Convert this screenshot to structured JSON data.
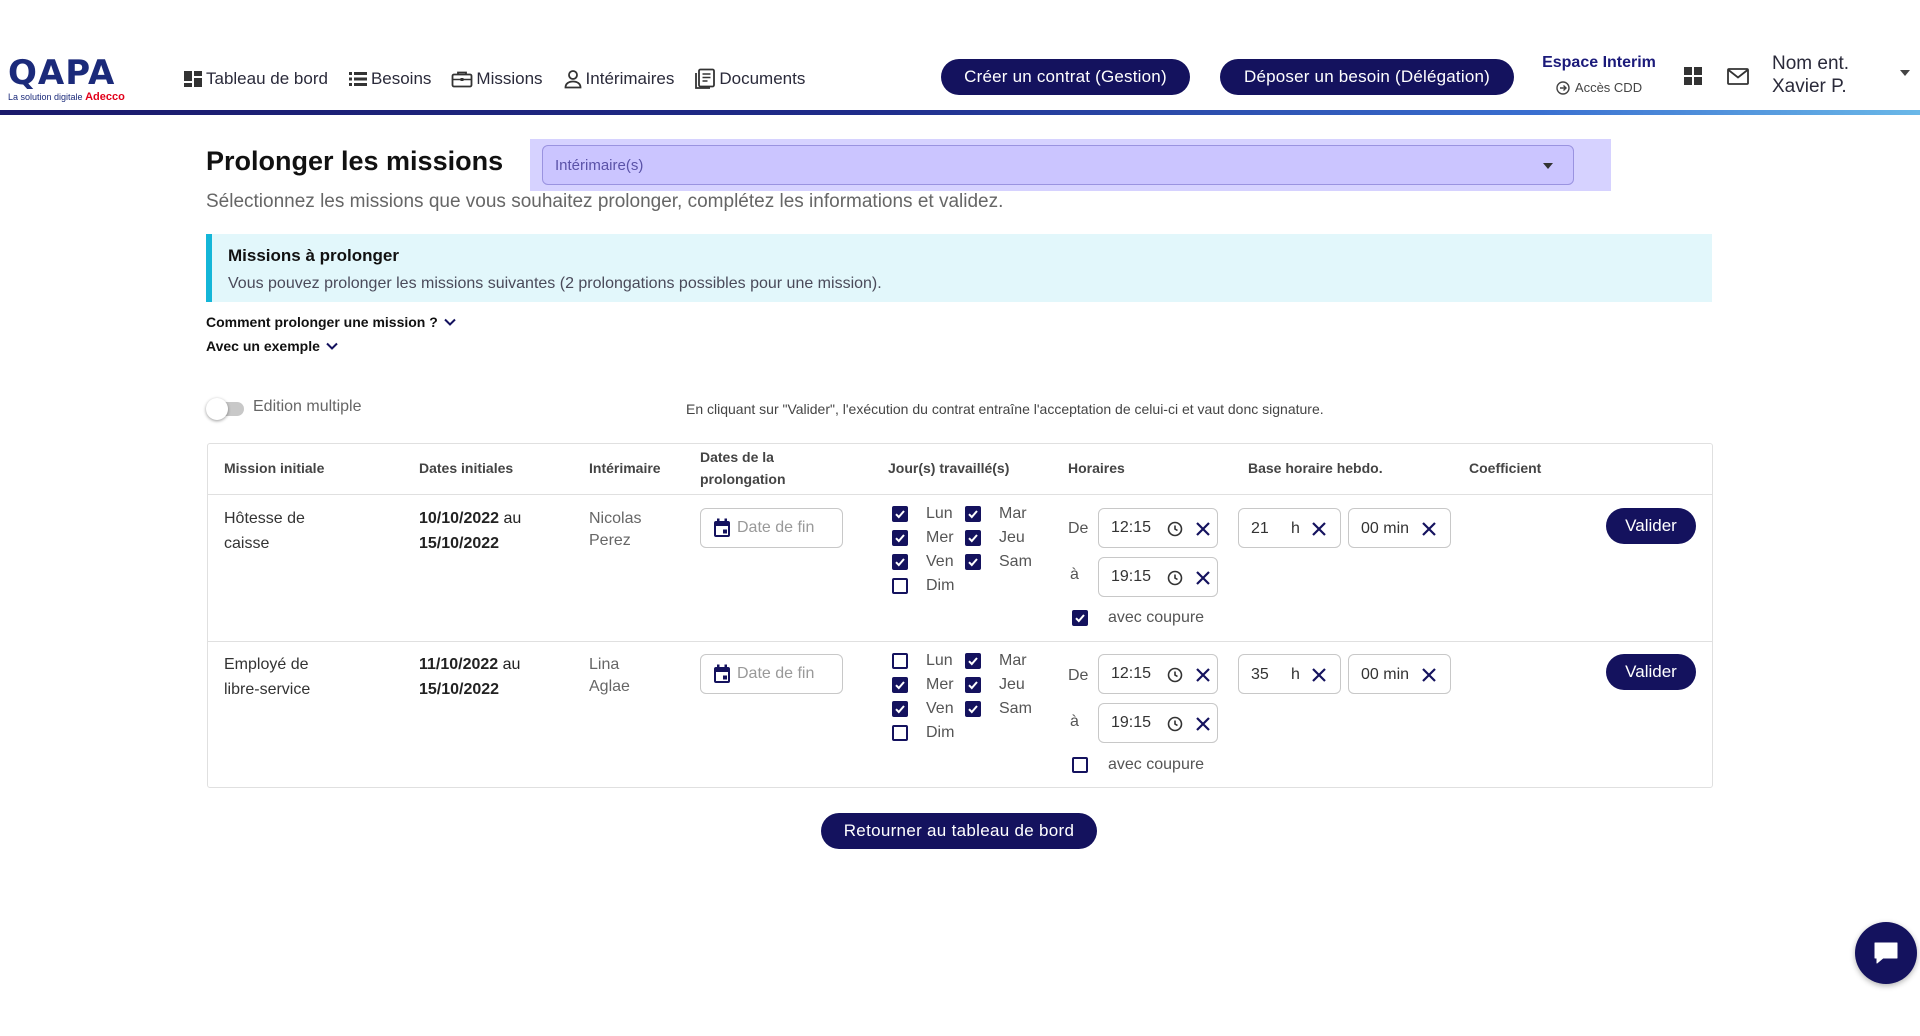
{
  "logo": {
    "main": "QAPA",
    "sub": "La solution digitale",
    "brand": "Adecco"
  },
  "nav": [
    {
      "label": "Tableau de bord",
      "icon": "dashboard-icon"
    },
    {
      "label": "Besoins",
      "icon": "list-icon"
    },
    {
      "label": "Missions",
      "icon": "briefcase-icon"
    },
    {
      "label": "Intérimaires",
      "icon": "person-icon"
    },
    {
      "label": "Documents",
      "icon": "documents-icon"
    }
  ],
  "header": {
    "create_contract_label": "Créer un contrat (Gestion)",
    "post_need_label": "Déposer un besoin (Délégation)",
    "espace_title": "Espace Interim",
    "espace_sub": "Accès CDD",
    "user_company": "Nom ent.",
    "user_name": "Xavier P."
  },
  "page": {
    "title": "Prolonger les missions",
    "select_placeholder": "Intérimaire(s)",
    "subtitle": "Sélectionnez les missions que vous souhaitez prolonger, complétez les informations et validez."
  },
  "info": {
    "title": "Missions à prolonger",
    "text": "Vous pouvez prolonger les missions suivantes (2 prolongations possibles pour une mission)."
  },
  "help": {
    "how_label": "Comment prolonger une mission ?",
    "example_label": "Avec un exemple"
  },
  "edition_multiple_label": "Edition multiple",
  "disclaimer": "En cliquant sur \"Valider\", l'exécution du contrat entraîne l'acceptation de celui-ci et vaut donc signature.",
  "table": {
    "headers": {
      "mission": "Mission initiale",
      "dates": "Dates initiales",
      "interimaire": "Intérimaire",
      "prolongation_1": "Dates de la",
      "prolongation_2": "prolongation",
      "jours": "Jour(s) travaillé(s)",
      "horaires": "Horaires",
      "base": "Base horaire hebdo.",
      "coefficient": "Coefficient"
    },
    "labels": {
      "de": "De",
      "a": "à",
      "h": "h",
      "coupure": "avec coupure",
      "date_placeholder": "Date de fin",
      "valider": "Valider",
      "au": "au"
    },
    "rows": [
      {
        "mission_1": "Hôtesse de",
        "mission_2": "caisse",
        "date_start": "10/10/2022",
        "date_end": "15/10/2022",
        "interimaire_1": "Nicolas",
        "interimaire_2": "Perez",
        "days": {
          "lun": {
            "label": "Lun",
            "checked": true
          },
          "mar": {
            "label": "Mar",
            "checked": true
          },
          "mer": {
            "label": "Mer",
            "checked": true
          },
          "jeu": {
            "label": "Jeu",
            "checked": true
          },
          "ven": {
            "label": "Ven",
            "checked": true
          },
          "sam": {
            "label": "Sam",
            "checked": true
          },
          "dim": {
            "label": "Dim",
            "checked": false
          }
        },
        "time_from": "12:15",
        "time_to": "19:15",
        "coupure": true,
        "hours": "21",
        "minutes": "00 min"
      },
      {
        "mission_1": "Employé de",
        "mission_2": "libre-service",
        "date_start": "11/10/2022",
        "date_end": "15/10/2022",
        "interimaire_1": "Lina",
        "interimaire_2": "Aglae",
        "days": {
          "lun": {
            "label": "Lun",
            "checked": false
          },
          "mar": {
            "label": "Mar",
            "checked": true
          },
          "mer": {
            "label": "Mer",
            "checked": true
          },
          "jeu": {
            "label": "Jeu",
            "checked": true
          },
          "ven": {
            "label": "Ven",
            "checked": true
          },
          "sam": {
            "label": "Sam",
            "checked": true
          },
          "dim": {
            "label": "Dim",
            "checked": false
          }
        },
        "time_from": "12:15",
        "time_to": "19:15",
        "coupure": false,
        "hours": "35",
        "minutes": "00 min"
      }
    ]
  },
  "back_label": "Retourner au tableau de bord",
  "colors": {
    "primary": "#14125e",
    "info_bg": "#e2f7fb",
    "info_border": "#14b6d8",
    "highlight": "#d6d2ff"
  }
}
